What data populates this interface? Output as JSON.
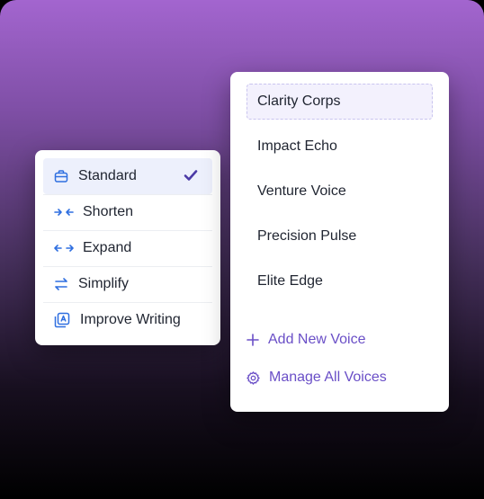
{
  "mode_menu": {
    "items": [
      {
        "label": "Standard",
        "icon": "briefcase-icon",
        "selected": true
      },
      {
        "label": "Shorten",
        "icon": "arrows-inward-icon"
      },
      {
        "label": "Expand",
        "icon": "arrows-outward-icon"
      },
      {
        "label": "Simplify",
        "icon": "swap-arrows-icon"
      },
      {
        "label": "Improve Writing",
        "icon": "magic-edit-icon"
      }
    ],
    "selected_indicator": "checkmark-icon"
  },
  "voice_menu": {
    "items": [
      {
        "label": "Clarity Corps",
        "selected": true
      },
      {
        "label": "Impact Echo"
      },
      {
        "label": "Venture Voice"
      },
      {
        "label": "Precision Pulse"
      },
      {
        "label": "Elite Edge"
      }
    ],
    "add_label": "Add New Voice",
    "manage_label": "Manage All Voices"
  },
  "colors": {
    "accent": "#6a4fc7",
    "icon_blue": "#2f6fe0",
    "check": "#4b3aa6",
    "gradient_top": "#a365cf"
  }
}
